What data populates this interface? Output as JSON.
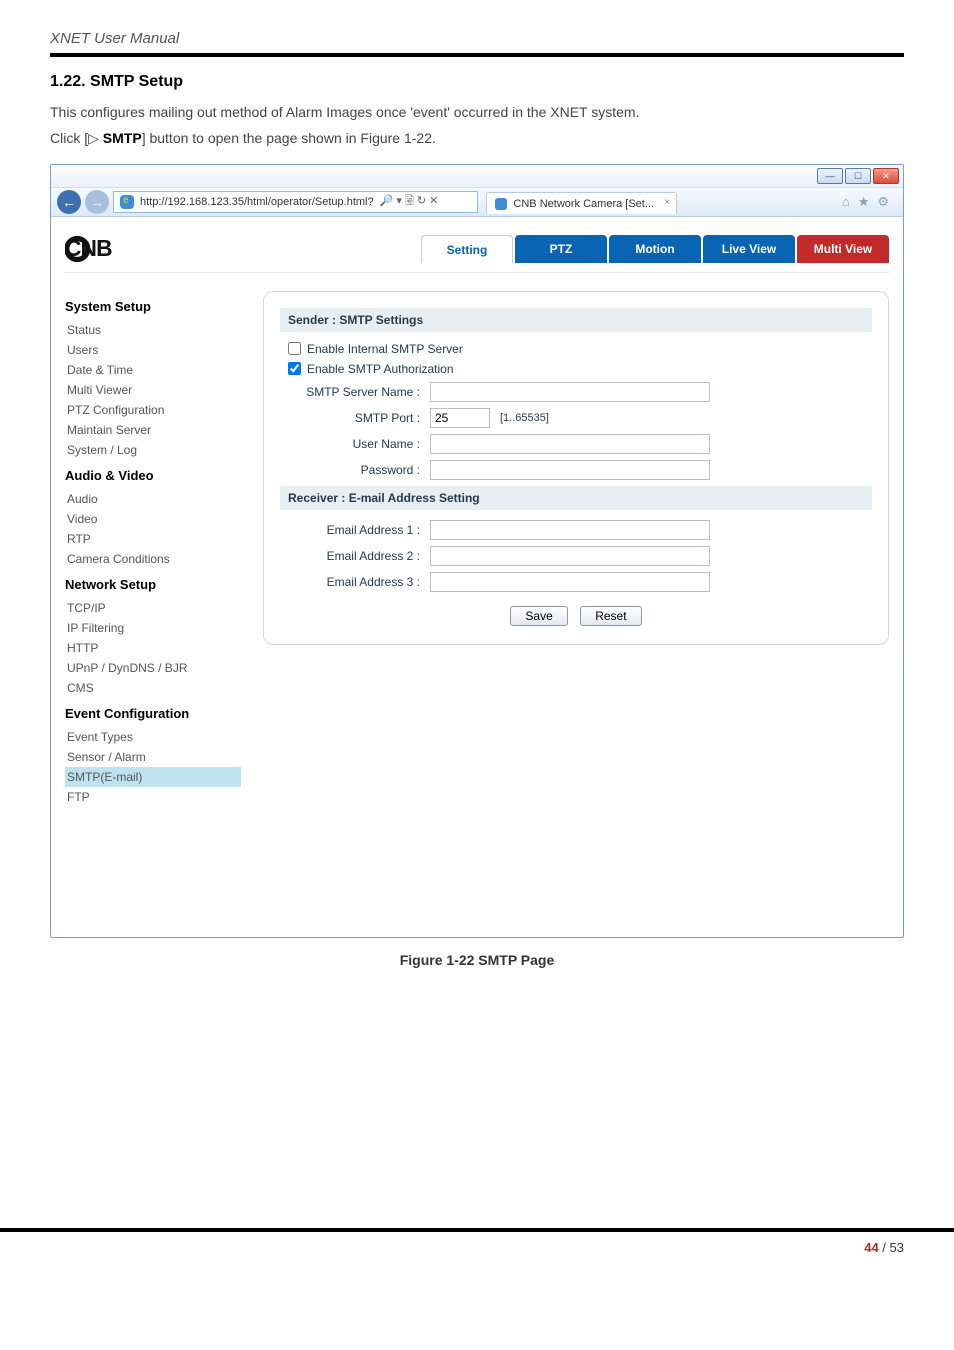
{
  "doc": {
    "header": "XNET User Manual",
    "section_number": "1.22. SMTP Setup",
    "intro1": "This configures mailing out method of Alarm Images once 'event' occurred in the XNET system.",
    "intro2_prefix": "Click [",
    "intro2_tri": "▷",
    "intro2_bold": " SMTP",
    "intro2_suffix": "] button to open the page shown in Figure 1-22.",
    "caption": "Figure 1-22 SMTP Page",
    "page_current": "44",
    "page_sep": " / ",
    "page_total": "53"
  },
  "browser": {
    "url": "http://192.168.123.35/html/operator/Setup.html?",
    "search_icons": "🔎 ▾  🗟 ↻ ✕",
    "tab_title": "CNB Network Camera [Set...",
    "win_min": "—",
    "win_max": "☐",
    "win_close": "✕",
    "tool_home": "⌂",
    "tool_star": "★",
    "tool_gear": "⚙"
  },
  "topnav": {
    "brand": "CNB",
    "setting": "Setting",
    "ptz": "PTZ",
    "motion": "Motion",
    "liveview": "Live View",
    "multiview": "Multi View"
  },
  "sidebar": {
    "g1": "System Setup",
    "g1_items": [
      "Status",
      "Users",
      "Date & Time",
      "Multi Viewer",
      "PTZ Configuration",
      "Maintain Server",
      "System / Log"
    ],
    "g2": "Audio & Video",
    "g2_items": [
      "Audio",
      "Video",
      "RTP",
      "Camera Conditions"
    ],
    "g3": "Network Setup",
    "g3_items": [
      "TCP/IP",
      "IP Filtering",
      "HTTP",
      "UPnP / DynDNS / BJR",
      "CMS"
    ],
    "g4": "Event Configuration",
    "g4_items": [
      "Event Types",
      "Sensor / Alarm",
      "SMTP(E-mail)",
      "FTP"
    ]
  },
  "form": {
    "sender_head": "Sender : SMTP Settings",
    "chk_internal": "Enable Internal SMTP Server",
    "chk_auth": "Enable SMTP Authorization",
    "lbl_server": "SMTP Server Name :",
    "lbl_port": "SMTP Port :",
    "port_value": "25",
    "port_hint": "[1..65535]",
    "lbl_user": "User Name :",
    "lbl_pass": "Password :",
    "recv_head": "Receiver : E-mail Address Setting",
    "lbl_e1": "Email Address 1 :",
    "lbl_e2": "Email Address 2 :",
    "lbl_e3": "Email Address 3 :",
    "btn_save": "Save",
    "btn_reset": "Reset"
  }
}
